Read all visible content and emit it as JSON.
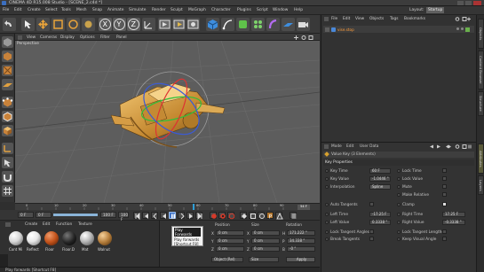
{
  "window": {
    "title": "CINEMA 4D R15.008 Studio - [SCENE_2.c4d *]"
  },
  "menubar": {
    "items": [
      "File",
      "Edit",
      "Create",
      "Select",
      "Tools",
      "Mesh",
      "Snap",
      "Animate",
      "Simulate",
      "Render",
      "Sculpt",
      "MoGraph",
      "Character",
      "Plugins",
      "Script",
      "Window",
      "Help"
    ],
    "layout_label": "Layout:",
    "layout_value": "Startup"
  },
  "viewport": {
    "menu": [
      "View",
      "Cameras",
      "Display",
      "Options",
      "Filter",
      "Panel"
    ],
    "label": "Perspective"
  },
  "timeline": {
    "ticks": [
      "0",
      "5",
      "10",
      "15",
      "20",
      "25",
      "30",
      "35",
      "40",
      "45",
      "50",
      "55",
      "60",
      "65",
      "70",
      "75",
      "80",
      "85",
      "90"
    ],
    "frame_badge": "54 F"
  },
  "transport": {
    "start": "0 F",
    "current": "0 F",
    "end": "100 F",
    "end2": "100 F"
  },
  "materials": {
    "menu": [
      "Create",
      "Edit",
      "Function",
      "Texture"
    ],
    "items": [
      {
        "label": "Cont Mi",
        "color": "#d8d8d8"
      },
      {
        "label": "Reflect",
        "color": "#e7e7e7"
      },
      {
        "label": "Floor",
        "color": "#c2521a"
      },
      {
        "label": "Floor.D",
        "color": "#222222"
      },
      {
        "label": "Mat",
        "color": "#b8b8b8"
      },
      {
        "label": "Walnut",
        "color": "#b57e3c"
      }
    ]
  },
  "coordinates": {
    "headers": [
      "Position",
      "Size",
      "Rotation"
    ],
    "rows": [
      {
        "axis": "X",
        "pos": "0 cm",
        "saxis": "X",
        "size": "0 cm",
        "raxis": "H",
        "rot": "171.222 °"
      },
      {
        "axis": "Y",
        "pos": "0 cm",
        "saxis": "Y",
        "size": "0 cm",
        "raxis": "P",
        "rot": "34.338 °"
      },
      {
        "axis": "Z",
        "pos": "0 cm",
        "saxis": "Z",
        "size": "0 cm",
        "raxis": "B",
        "rot": "-0 °"
      }
    ],
    "mode1": "Object (Rel)",
    "mode2": "Size",
    "apply": "Apply"
  },
  "tooltip": {
    "lines": [
      "Play Forwards",
      "Play forwards",
      "[Shortcut F8]"
    ]
  },
  "statusbar": {
    "text": "Play forwards [Shortcut F8]"
  },
  "objects": {
    "menu": [
      "File",
      "Edit",
      "View",
      "Objects",
      "Tags",
      "Bookmarks"
    ],
    "items": [
      {
        "name": "vise.stop"
      }
    ]
  },
  "attributes": {
    "menu": [
      "Mode",
      "Edit",
      "User Data"
    ],
    "header": "Value Key (3 Elements)",
    "section": "Key Properties",
    "left": [
      {
        "label": "Key Time",
        "value": "60 F"
      },
      {
        "label": "Key Value",
        "value": "-1.0446 °"
      },
      {
        "label": "Interpolation",
        "value": "Spline"
      }
    ],
    "right": [
      {
        "label": "Lock Time"
      },
      {
        "label": "Lock Value"
      },
      {
        "label": "Mute"
      },
      {
        "label": "Make Relative"
      }
    ],
    "auto_tangents": "Auto Tangents",
    "clamp": "Clamp",
    "tan_left": [
      {
        "label": "Left Time",
        "value": "-17.25 F"
      },
      {
        "label": "Left Value",
        "value": "0.3338 °"
      }
    ],
    "tan_right": [
      {
        "label": "Right Time",
        "value": "17.25 F"
      },
      {
        "label": "Right Value",
        "value": "-0.3338 °"
      }
    ],
    "bottom_left": [
      "Lock Tangent Angles",
      "Break Tangents"
    ],
    "bottom_right": [
      "Lock Tangent Lengths",
      "Keep Visual Angle"
    ]
  },
  "side_tabs": [
    "Objects",
    "Content Browser",
    "Structure",
    "Attributes",
    "Layers"
  ]
}
